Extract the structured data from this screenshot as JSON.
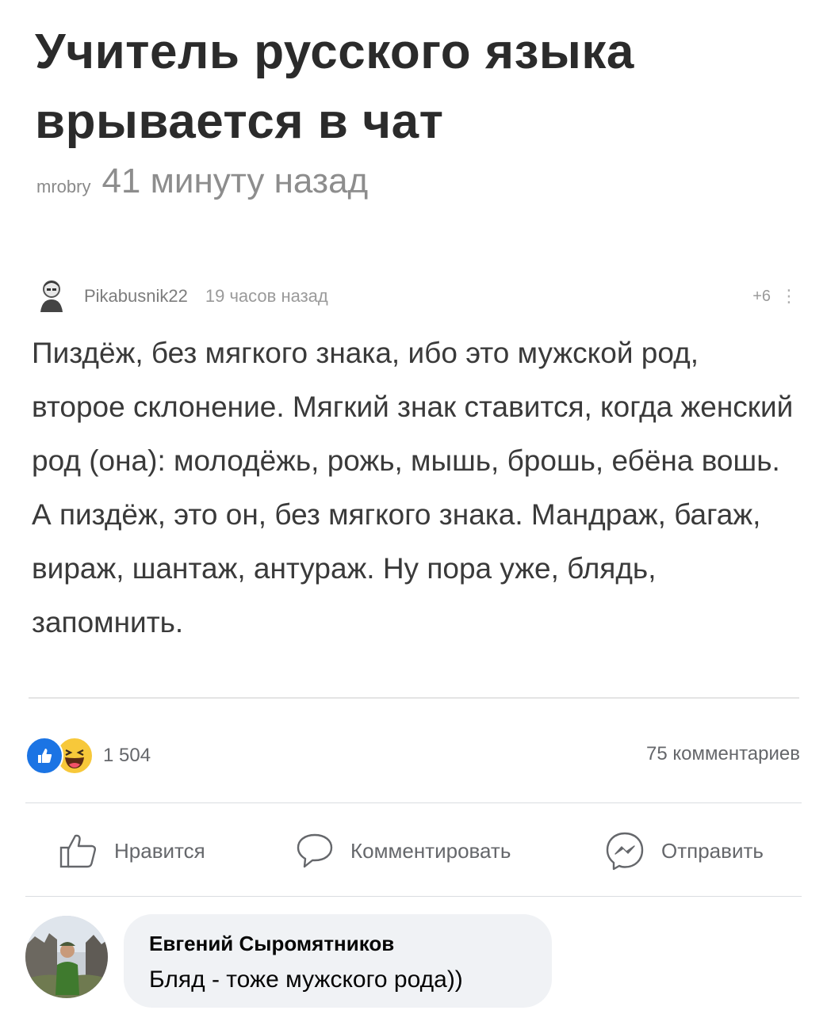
{
  "post": {
    "title": "Учитель русского языка врывается в чат",
    "author": "mrobry",
    "time": "41 минуту назад"
  },
  "comment": {
    "username": "Pikabusnik22",
    "time": "19 часов назад",
    "rating": "+6",
    "menu": "⋮",
    "text": "Пиздёж, без мягкого знака, ибо это мужской род, второе склонение. Мягкий знак ставится, когда женский род (она): молодёжь, рожь, мышь, брошь, ебёна вошь. А пиздёж, это он, без мягкого знака. Мандраж, багаж, вираж, шантаж, антураж. Ну пора уже, блядь, запомнить."
  },
  "reactions": {
    "count": "1 504",
    "icons": [
      "like-icon",
      "haha-icon"
    ],
    "like_color": "#1b74e4",
    "haha_color": "#f7c83a"
  },
  "comments_count": "75 комментариев",
  "actions": {
    "like_label": "Нравится",
    "comment_label": "Комментировать",
    "send_label": "Отправить"
  },
  "reply": {
    "name": "Евгений Сыромятников",
    "text": "Бляд - тоже мужского рода))"
  }
}
